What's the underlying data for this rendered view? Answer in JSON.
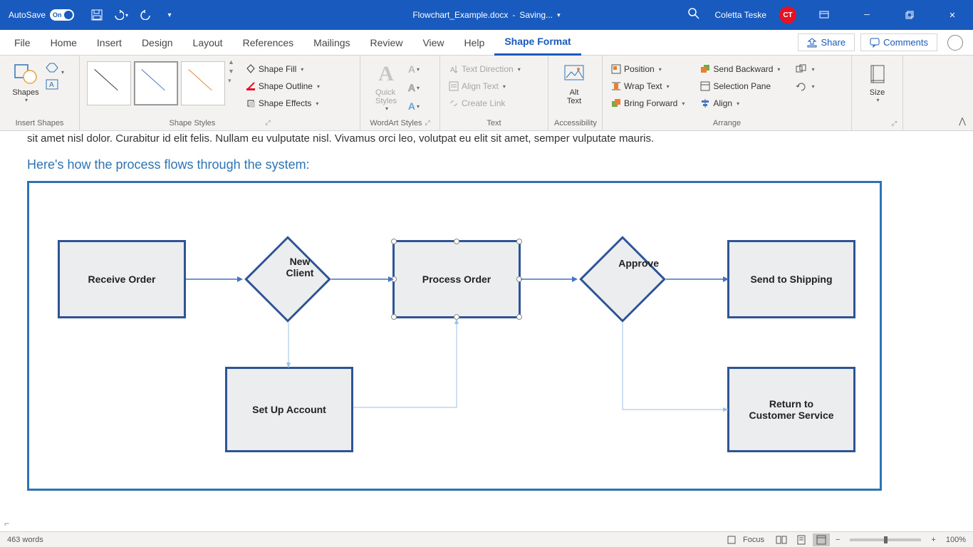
{
  "titlebar": {
    "autosave_label": "AutoSave",
    "autosave_state": "On",
    "doc_name": "Flowchart_Example.docx",
    "doc_status": "Saving...",
    "user_name": "Coletta Teske",
    "user_initials": "CT"
  },
  "tabs": {
    "file": "File",
    "home": "Home",
    "insert": "Insert",
    "design": "Design",
    "layout": "Layout",
    "references": "References",
    "mailings": "Mailings",
    "review": "Review",
    "view": "View",
    "help": "Help",
    "shape_format": "Shape Format",
    "share": "Share",
    "comments": "Comments"
  },
  "ribbon": {
    "shapes_btn": "Shapes",
    "insert_shapes_label": "Insert Shapes",
    "shape_styles_label": "Shape Styles",
    "shape_fill": "Shape Fill",
    "shape_outline": "Shape Outline",
    "shape_effects": "Shape Effects",
    "wordart_styles_label": "WordArt Styles",
    "quick_styles": "Quick Styles",
    "text_label": "Text",
    "text_direction": "Text Direction",
    "align_text": "Align Text",
    "create_link": "Create Link",
    "accessibility_label": "Accessibility",
    "alt_text_line1": "Alt",
    "alt_text_line2": "Text",
    "arrange_label": "Arrange",
    "position": "Position",
    "wrap_text": "Wrap Text",
    "bring_forward": "Bring Forward",
    "send_backward": "Send Backward",
    "selection_pane": "Selection Pane",
    "align": "Align",
    "size_label": "Size"
  },
  "document": {
    "fragment_text": "sit amet nisl dolor. Curabitur id elit felis. Nullam eu vulputate nisl. Vivamus orci leo, volutpat eu elit sit amet, semper vulputate mauris.",
    "heading": "Here's how the process flows through the system:",
    "boxes": {
      "receive_order": "Receive Order",
      "new_client": "New Client",
      "process_order": "Process Order",
      "approve": "Approve",
      "send_shipping": "Send to Shipping",
      "setup_account": "Set Up Account",
      "return_cs_line1": "Return to",
      "return_cs_line2": "Customer Service"
    }
  },
  "statusbar": {
    "words": "463 words",
    "focus": "Focus",
    "zoom": "100%"
  }
}
